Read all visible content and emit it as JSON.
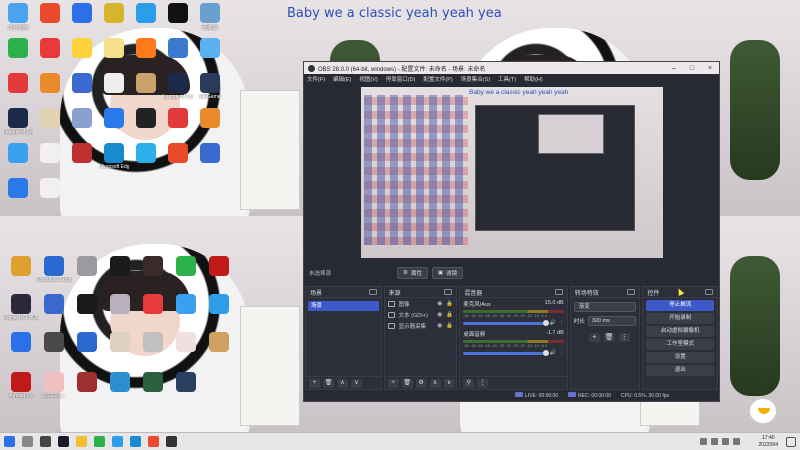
{
  "desktop": {
    "lyric": "Baby we a classic yeah yeah yea",
    "icons_top": [
      {
        "label": "这台电脑",
        "color": "#4aa3f0"
      },
      {
        "label": "",
        "color": "#e94a2b"
      },
      {
        "label": "",
        "color": "#2b6fe9"
      },
      {
        "label": "",
        "color": "#d6b42b"
      },
      {
        "label": "",
        "color": "#2b9de9"
      },
      {
        "label": "",
        "color": "#111111"
      },
      {
        "label": "回收站",
        "color": "#6aa0d0"
      },
      {
        "label": "",
        "color": "#2bb04a"
      },
      {
        "label": "",
        "color": "#e93a3a"
      },
      {
        "label": "",
        "color": "#ffd23a"
      },
      {
        "label": "",
        "color": "#f5e08a"
      },
      {
        "label": "",
        "color": "#ff7a1a"
      },
      {
        "label": "",
        "color": "#3a7ad0"
      },
      {
        "label": "",
        "color": "#5ab0f0"
      },
      {
        "label": "",
        "color": "#e23a3a"
      },
      {
        "label": "",
        "color": "#e98a2b"
      },
      {
        "label": "",
        "color": "#3a6ad0"
      },
      {
        "label": "",
        "color": "#eee"
      },
      {
        "label": "",
        "color": "#c9a36b"
      },
      {
        "label": "League of Legends",
        "color": "#1c2a4a"
      },
      {
        "label": "WeGame",
        "color": "#2a3a5a"
      },
      {
        "label": "League of Legends",
        "color": "#1c2a4a"
      },
      {
        "label": "",
        "color": "#e0d4b0"
      },
      {
        "label": "",
        "color": "#8aa0d0"
      },
      {
        "label": "",
        "color": "#2b7ae9"
      },
      {
        "label": "",
        "color": "#222"
      },
      {
        "label": "",
        "color": "#e23a3a"
      },
      {
        "label": "",
        "color": "#e98a2b"
      },
      {
        "label": "",
        "color": "#3aa0f0"
      },
      {
        "label": "",
        "color": "#f0f0f0"
      },
      {
        "label": "",
        "color": "#c03030"
      },
      {
        "label": "Microsoft Edge",
        "color": "#1a8ad0"
      },
      {
        "label": "",
        "color": "#2bb0e9"
      },
      {
        "label": "",
        "color": "#e94a2b"
      },
      {
        "label": "",
        "color": "#3a6ad0"
      },
      {
        "label": "",
        "color": "#2b7ae9"
      },
      {
        "label": "",
        "color": "#f0f0f0"
      }
    ],
    "icons_bottom": [
      {
        "label": "",
        "color": "#e0a030"
      },
      {
        "label": "Wallpaper Engine",
        "color": "#2a6ad0"
      },
      {
        "label": "",
        "color": "#9a9aa0"
      },
      {
        "label": "",
        "color": "#1a1a1a"
      },
      {
        "label": "",
        "color": "#3a2a2a"
      },
      {
        "label": "",
        "color": "#2bb04a"
      },
      {
        "label": "",
        "color": "#c01a1a"
      },
      {
        "label": "Logitech G HUB",
        "color": "#2a2a3a"
      },
      {
        "label": "",
        "color": "#3a6ad0"
      },
      {
        "label": "",
        "color": "#1a1a1a"
      },
      {
        "label": "",
        "color": "#b9b0c0"
      },
      {
        "label": "",
        "color": "#e93a3a"
      },
      {
        "label": "",
        "color": "#3aa0f0"
      },
      {
        "label": "",
        "color": "#2b9de9"
      },
      {
        "label": "",
        "color": "#2b6fe9"
      },
      {
        "label": "",
        "color": "#4a4a4a"
      },
      {
        "label": "",
        "color": "#2a6ad0"
      },
      {
        "label": "",
        "color": "#e0d0c0"
      },
      {
        "label": "",
        "color": "#c0c0c0"
      },
      {
        "label": "",
        "color": "#f0e0e0"
      },
      {
        "label": "",
        "color": "#d0a060"
      },
      {
        "label": "Among Us",
        "color": "#c01a1a"
      },
      {
        "label": "2022060...",
        "color": "#f0c0c0"
      },
      {
        "label": "",
        "color": "#a03030"
      },
      {
        "label": "",
        "color": "#2a90d0"
      },
      {
        "label": "",
        "color": "#2a6040"
      },
      {
        "label": "",
        "color": "#2a4060"
      }
    ]
  },
  "obs": {
    "title": "OBS 28.0.0 (64-bit, windows) - 配置文件: 未命名 - 场景: 未命名",
    "menu": [
      "文件(F)",
      "编辑(E)",
      "视图(V)",
      "停靠窗口(D)",
      "配置文件(P)",
      "场景集合(S)",
      "工具(T)",
      "帮助(H)"
    ],
    "preview_lyric": "Baby we a classic yeah yeah yeah",
    "no_source_label": "未选择源",
    "properties_btn": "属性",
    "filters_btn": "滤镜",
    "scenes": {
      "title": "场景",
      "selected": "场景"
    },
    "sources": {
      "title": "来源",
      "items": [
        {
          "label": "图像"
        },
        {
          "label": "文本 (GDI+)"
        },
        {
          "label": "显示器采集"
        }
      ]
    },
    "mixer": {
      "title": "混音器",
      "channels": [
        {
          "name": "麦克风/Aux",
          "db": "15.0 dB"
        },
        {
          "name": "桌面音频",
          "db": "-1.7 dB"
        }
      ],
      "ticks": "-60 -55 -50 -45 -40 -35 -30 -25 -20 -15 -10 -5 0"
    },
    "transitions": {
      "title": "转场特效",
      "selected": "渐变",
      "duration_label": "时长",
      "duration": "300 ms"
    },
    "controls": {
      "title": "控件",
      "buttons": [
        "停止推流",
        "开始录制",
        "启动虚拟摄像机",
        "工作室模式",
        "设置",
        "退出"
      ]
    },
    "status": {
      "live": "LIVE: 00:00:00",
      "rec": "REC: 00:00:00",
      "cpu": "CPU: 0.5%, 30.00 fps"
    }
  },
  "taskbar": {
    "time": "17:40",
    "date": "2022/9/4"
  }
}
